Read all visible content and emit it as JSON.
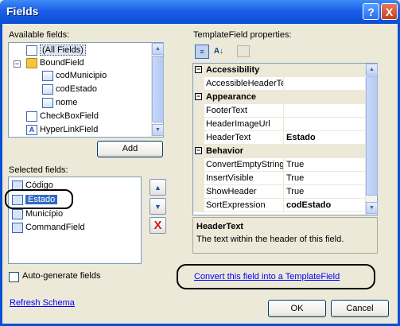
{
  "window": {
    "title": "Fields",
    "help_label": "?",
    "close_label": "X"
  },
  "available": {
    "label": "Available fields:",
    "items": [
      {
        "label": "(All Fields)",
        "icon": "all-fields-icon"
      },
      {
        "label": "BoundField",
        "icon": "folder-icon"
      },
      {
        "label": "codMunicipio",
        "icon": "field-icon"
      },
      {
        "label": "codEstado",
        "icon": "field-icon"
      },
      {
        "label": "nome",
        "icon": "field-icon"
      },
      {
        "label": "CheckBoxField",
        "icon": "checkbox-field-icon"
      },
      {
        "label": "HyperLinkField",
        "icon": "hyperlink-field-icon"
      }
    ],
    "add_label": "Add"
  },
  "selected": {
    "label": "Selected fields:",
    "items": [
      {
        "label": "Código"
      },
      {
        "label": "Estado"
      },
      {
        "label": "Município"
      },
      {
        "label": "CommandField"
      }
    ],
    "up_label": "▲",
    "down_label": "▼",
    "delete_label": "X"
  },
  "auto_generate": {
    "label": "Auto-generate fields",
    "checked": false
  },
  "refresh_label": "Refresh Schema",
  "properties": {
    "label": "TemplateField properties:",
    "rows": [
      {
        "type": "cat",
        "name": "Accessibility"
      },
      {
        "type": "prop",
        "name": "AccessibleHeaderTe",
        "value": ""
      },
      {
        "type": "cat",
        "name": "Appearance"
      },
      {
        "type": "prop",
        "name": "FooterText",
        "value": ""
      },
      {
        "type": "prop",
        "name": "HeaderImageUrl",
        "value": ""
      },
      {
        "type": "prop",
        "name": "HeaderText",
        "value": "Estado",
        "bold": true
      },
      {
        "type": "cat",
        "name": "Behavior"
      },
      {
        "type": "prop",
        "name": "ConvertEmptyString",
        "value": "True"
      },
      {
        "type": "prop",
        "name": "InsertVisible",
        "value": "True"
      },
      {
        "type": "prop",
        "name": "ShowHeader",
        "value": "True"
      },
      {
        "type": "prop",
        "name": "SortExpression",
        "value": "codEstado",
        "bold": true
      }
    ],
    "desc_title": "HeaderText",
    "desc_text": "The text within the header of this field."
  },
  "convert_link": "Convert this field into a TemplateField",
  "ok_label": "OK",
  "cancel_label": "Cancel"
}
